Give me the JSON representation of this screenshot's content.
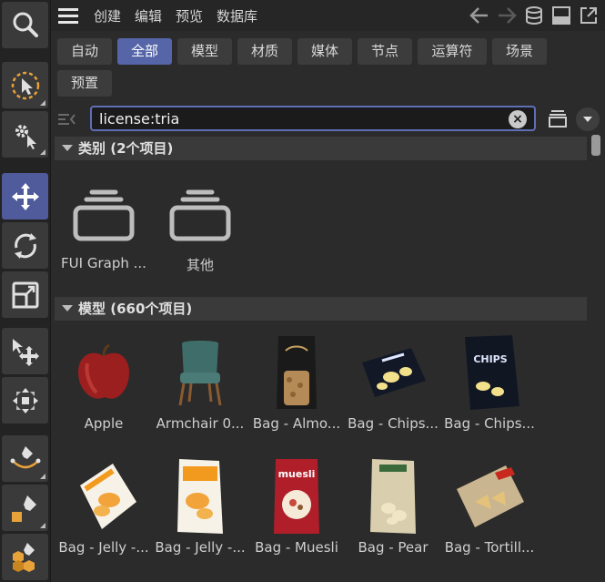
{
  "menubar": {
    "items": [
      "创建",
      "编辑",
      "预览",
      "数据库"
    ]
  },
  "chips": [
    {
      "label": "自动",
      "active": false
    },
    {
      "label": "全部",
      "active": true
    },
    {
      "label": "模型",
      "active": false
    },
    {
      "label": "材质",
      "active": false
    },
    {
      "label": "媒体",
      "active": false
    },
    {
      "label": "节点",
      "active": false
    },
    {
      "label": "运算符",
      "active": false
    },
    {
      "label": "场景",
      "active": false
    },
    {
      "label": "预置",
      "active": false
    }
  ],
  "search": {
    "value": "license:tria",
    "clear_glyph": "×"
  },
  "sections": {
    "categories": {
      "title": "类别 (2个项目)",
      "items": [
        {
          "label": "FUI Graph ...",
          "icon": "folder-stack-icon"
        },
        {
          "label": "其他",
          "icon": "folder-stack-icon"
        }
      ]
    },
    "models": {
      "title": "模型 (660个项目)",
      "items": [
        {
          "label": "Apple",
          "icon": "apple-thumbnail"
        },
        {
          "label": "Armchair 0...",
          "icon": "armchair-thumbnail"
        },
        {
          "label": "Bag - Almo...",
          "icon": "bag-almond-thumbnail"
        },
        {
          "label": "Bag - Chips...",
          "icon": "bag-chips-thumbnail"
        },
        {
          "label": "Bag - Chips...",
          "icon": "bag-chips-dark-thumbnail"
        },
        {
          "label": "Bag - Jelly -...",
          "icon": "bag-jelly-thumbnail"
        },
        {
          "label": "Bag - Jelly -...",
          "icon": "bag-jelly-2-thumbnail"
        },
        {
          "label": "Bag - Muesli",
          "icon": "bag-muesli-thumbnail"
        },
        {
          "label": "Bag - Pear",
          "icon": "bag-pear-thumbnail"
        },
        {
          "label": "Bag - Tortill...",
          "icon": "bag-tortilla-thumbnail"
        }
      ]
    }
  },
  "colors": {
    "accent": "#5565a8",
    "background": "#2b2b2b"
  }
}
